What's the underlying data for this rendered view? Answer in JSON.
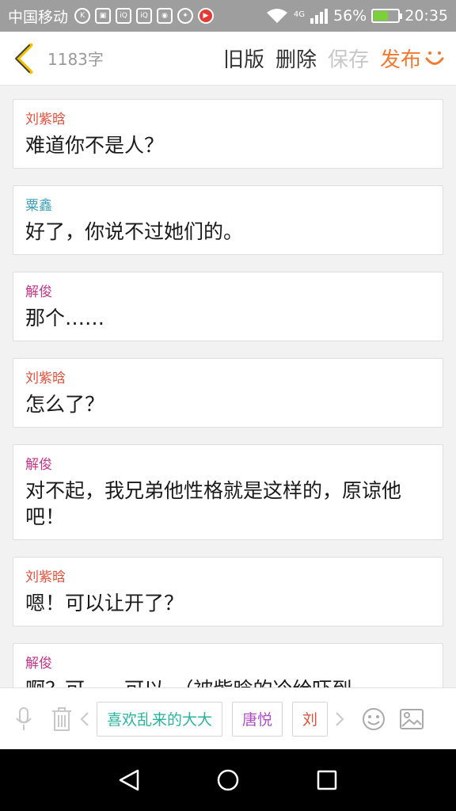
{
  "status": {
    "carrier": "中国移动",
    "network": "4G",
    "battery": "56%",
    "battery_level": 0.56,
    "time": "20:35"
  },
  "header": {
    "word_count": "1183字",
    "old_version": "旧版",
    "delete": "删除",
    "save": "保存",
    "publish": "发布",
    "colors": {
      "publish": "#f07a30",
      "disabled": "#c8c8c8"
    }
  },
  "messages": [
    {
      "name": "刘紫晗",
      "text": "难道你不是人？",
      "color": "#e0503a"
    },
    {
      "name": "粟鑫",
      "text": "好了，你说不过她们的。",
      "color": "#3fa0b8"
    },
    {
      "name": "解俊",
      "text": "那个……",
      "color": "#c2378a"
    },
    {
      "name": "刘紫晗",
      "text": "怎么了？",
      "color": "#e0503a"
    },
    {
      "name": "解俊",
      "text": "对不起，我兄弟他性格就是这样的，原谅他吧！",
      "color": "#c2378a"
    },
    {
      "name": "刘紫晗",
      "text": "嗯！可以让开了？",
      "color": "#e0503a"
    },
    {
      "name": "解俊",
      "text": "啊？可……可以。（被紫晗的冷给吓到",
      "color": "#c2378a"
    }
  ],
  "toolbar": {
    "chips": [
      {
        "label": "喜欢乱来的大大",
        "color": "#2bb3a0"
      },
      {
        "label": "唐悦",
        "color": "#b04fc8"
      },
      {
        "label": "刘",
        "color": "#e0503a"
      }
    ],
    "icons": [
      "microphone-icon",
      "trash-icon",
      "chevron-left-icon",
      "chevron-right-icon",
      "emoji-icon",
      "image-icon"
    ]
  }
}
